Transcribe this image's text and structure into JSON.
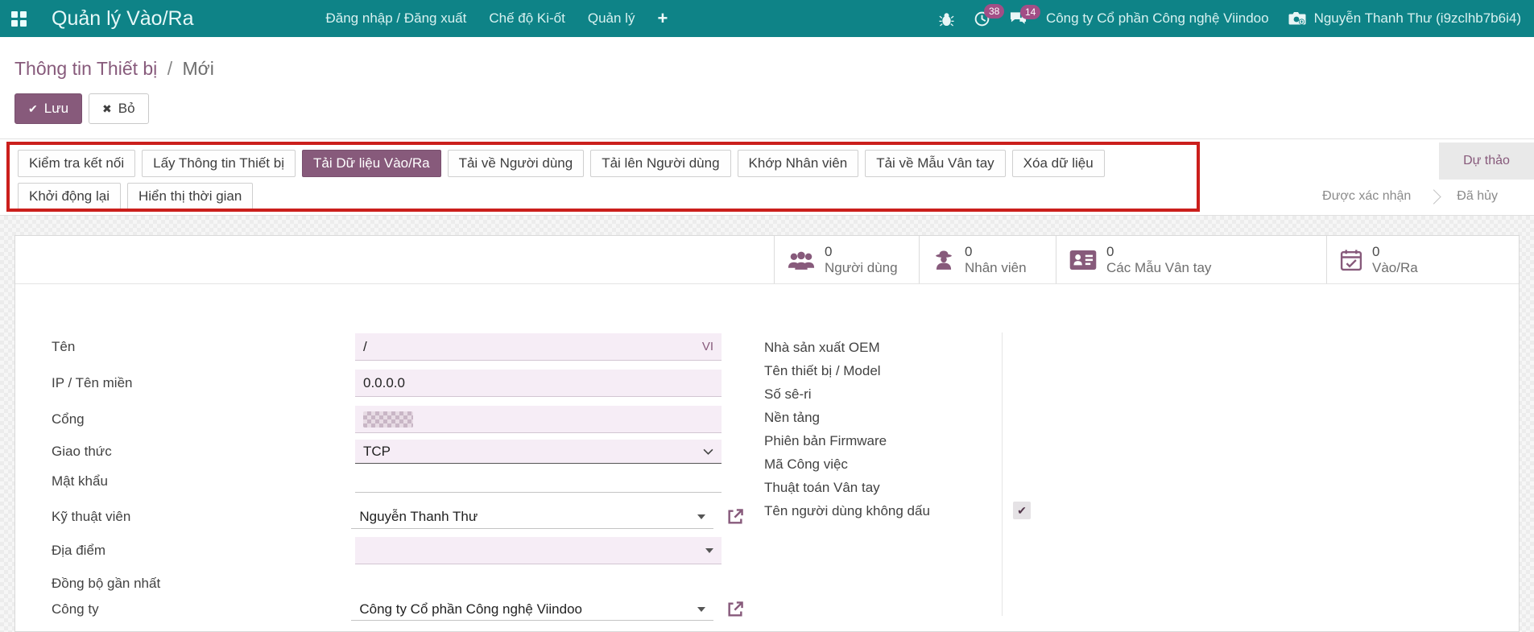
{
  "colors": {
    "topbar_teal": "#0E8387",
    "accent_purple": "#875A7B",
    "badge_pink": "#A24E86",
    "annotation_red": "#CB1F1C",
    "field_lavender": "#F6EDF6"
  },
  "topbar": {
    "app_title": "Quản lý Vào/Ra",
    "menu": [
      {
        "label": "Đăng nhập / Đăng xuất"
      },
      {
        "label": "Chế độ Ki-ốt"
      },
      {
        "label": "Quản lý"
      },
      {
        "label": "+"
      }
    ],
    "activity_badge": "38",
    "message_badge": "14",
    "company": "Công ty Cổ phần Công nghệ Viindoo",
    "user": "Nguyễn Thanh Thư (i9zclhb7b6i4)"
  },
  "breadcrumb": {
    "parent": "Thông tin Thiết bị",
    "separator": "/",
    "current": "Mới"
  },
  "form_actions": {
    "save": "Lưu",
    "discard": "Bỏ",
    "save_icon": "✔",
    "discard_icon": "✖"
  },
  "device_actions": {
    "row1": [
      {
        "label": "Kiểm tra kết nối"
      },
      {
        "label": "Lấy Thông tin Thiết bị"
      },
      {
        "label": "Tải Dữ liệu Vào/Ra",
        "active": true
      },
      {
        "label": "Tải về Người dùng"
      },
      {
        "label": "Tải lên Người dùng"
      },
      {
        "label": "Khớp Nhân viên"
      },
      {
        "label": "Tải về Mẫu Vân tay"
      },
      {
        "label": "Xóa dữ liệu"
      }
    ],
    "row2": [
      {
        "label": "Khởi động lại"
      },
      {
        "label": "Hiển thị thời gian"
      }
    ]
  },
  "statusbar": {
    "states": [
      {
        "label": "Dự thảo",
        "active": true
      },
      {
        "label": "Được xác nhận",
        "active": false
      },
      {
        "label": "Đã hủy",
        "active": false
      }
    ]
  },
  "stat_buttons": [
    {
      "icon": "users-icon",
      "value": "0",
      "label": "Người dùng"
    },
    {
      "icon": "employee-icon",
      "value": "0",
      "label": "Nhân viên"
    },
    {
      "icon": "fingerprint-card-icon",
      "value": "0",
      "label": "Các Mẫu Vân tay"
    },
    {
      "icon": "calendar-check-icon",
      "value": "0",
      "label": "Vào/Ra"
    }
  ],
  "form": {
    "left_fields": [
      {
        "label": "Tên",
        "value": "/",
        "lang_badge": "VI"
      },
      {
        "label": "IP / Tên miền",
        "value": "0.0.0.0"
      },
      {
        "label": "Cổng",
        "value": "",
        "redacted": true
      },
      {
        "label": "Giao thức",
        "value": "TCP",
        "widget": "select"
      },
      {
        "label": "Mật khẩu",
        "value": ""
      },
      {
        "label": "Kỹ thuật viên",
        "value": "Nguyễn Thanh Thư",
        "widget": "many2one",
        "external_link": true
      },
      {
        "label": "Địa điểm",
        "value": "",
        "widget": "many2one"
      },
      {
        "label": "Đồng bộ gần nhất",
        "value": ""
      },
      {
        "label": "Công ty",
        "value": "Công ty Cổ phần Công nghệ Viindoo",
        "widget": "many2one",
        "external_link": true
      }
    ],
    "right_fields": [
      {
        "label": "Nhà sản xuất OEM"
      },
      {
        "label": "Tên thiết bị / Model"
      },
      {
        "label": "Số sê-ri"
      },
      {
        "label": "Nền tảng"
      },
      {
        "label": "Phiên bản Firmware"
      },
      {
        "label": "Mã Công việc"
      },
      {
        "label": "Thuật toán Vân tay"
      },
      {
        "label": "Tên người dùng không dấu",
        "checkbox": true,
        "checked": true,
        "check_glyph": "✔"
      }
    ]
  }
}
